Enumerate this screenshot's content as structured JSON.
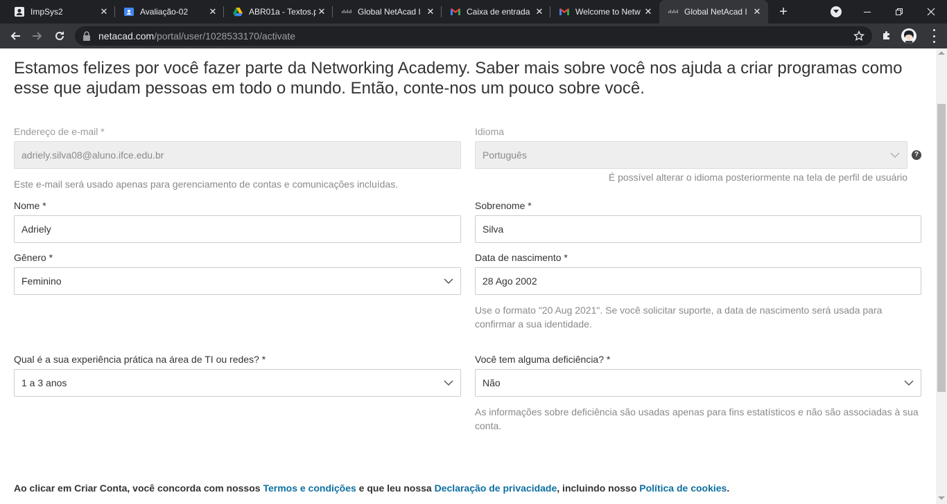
{
  "browser": {
    "tabs": [
      {
        "title": "ImpSys2",
        "icon": "account-box-icon"
      },
      {
        "title": "Avaliação-02",
        "icon": "google-classroom-icon"
      },
      {
        "title": "ABR01a - Textos.p",
        "icon": "google-drive-icon"
      },
      {
        "title": "Global NetAcad I",
        "icon": "cisco-icon"
      },
      {
        "title": "Caixa de entrada",
        "icon": "gmail-icon"
      },
      {
        "title": "Welcome to Netw",
        "icon": "gmail-icon"
      },
      {
        "title": "Global NetAcad I",
        "icon": "cisco-icon",
        "active": true
      }
    ],
    "url_host": "netacad.com",
    "url_path": "/portal/user/1028533170/activate"
  },
  "form": {
    "intro": "Estamos felizes por você fazer parte da Networking Academy. Saber mais sobre você nos ajuda a criar programas como esse que ajudam pessoas em todo o mundo. Então, conte-nos um pouco sobre você.",
    "email_label": "Endereço de e-mail *",
    "email_value": "adriely.silva08@aluno.ifce.edu.br",
    "email_help": "Este e-mail será usado apenas para gerenciamento de contas e comunicações incluídas.",
    "language_label": "Idioma",
    "language_value": "Português",
    "language_help": "É possível alterar o idioma posteriormente na tela de perfil de usuário",
    "language_help_icon": "?",
    "first_name_label": "Nome *",
    "first_name_value": "Adriely",
    "last_name_label": "Sobrenome *",
    "last_name_value": "Silva",
    "gender_label": "Gênero *",
    "gender_value": "Feminino",
    "birth_label": "Data de nascimento *",
    "birth_value": "28 Ago 2002",
    "birth_help": "Use o formato \"20 Aug 2021\". Se você solicitar suporte, a data de nascimento será usada para confirmar a sua identidade.",
    "experience_label": "Qual é a sua experiência prática na área de TI ou redes? *",
    "experience_value": "1 a 3 anos",
    "disability_label": "Você tem alguma deficiência? *",
    "disability_value": "Não",
    "disability_help": "As informações sobre deficiência são usadas apenas para fins estatísticos e não são associadas à sua conta.",
    "terms_prefix": "Ao clicar em Criar Conta, você concorda com nossos ",
    "terms_link": "Termos e condições",
    "terms_mid": " e que leu nossa ",
    "privacy_link": "Declaração de privacidade",
    "terms_mid2": ", incluindo nosso ",
    "cookies_link": "Política de cookies",
    "terms_end": "."
  },
  "colors": {
    "link": "#0d6fa0",
    "text": "#333333",
    "muted": "#8a8a8a"
  }
}
